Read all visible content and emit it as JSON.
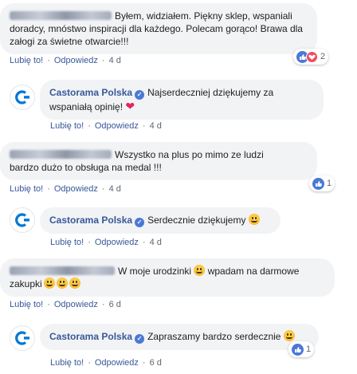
{
  "comments": [
    {
      "text": "Byłem, widziałem. Piękny sklep, wspaniali doradcy, mnóstwo inspiracji dla każdego. Polecam gorąco! Brawa dla załogi za świetne otwarcie!!!",
      "like_label": "Lubię to!",
      "reply_label": "Odpowiedz",
      "time": "4 d",
      "reactions_count": "2"
    },
    {
      "author": "Castorama Polska",
      "text": "Najserdeczniej dziękujemy za wspaniałą opinię!",
      "like_label": "Lubię to!",
      "reply_label": "Odpowiedz",
      "time": "4 d"
    },
    {
      "text": "Wszystko na plus po mimo ze ludzi bardzo dużo to obsługa na medal !!!",
      "like_label": "Lubię to!",
      "reply_label": "Odpowiedz",
      "time": "4 d",
      "reactions_count": "1"
    },
    {
      "author": "Castorama Polska",
      "text": "Serdecznie dziękujemy",
      "like_label": "Lubię to!",
      "reply_label": "Odpowiedz",
      "time": "4 d"
    },
    {
      "text_part1": "W moje urodzinki",
      "text_part2": "wpadam na darmowe zakupki",
      "like_label": "Lubię to!",
      "reply_label": "Odpowiedz",
      "time": "6 d"
    },
    {
      "author": "Castorama Polska",
      "text": "Zapraszamy bardzo serdecznie",
      "like_label": "Lubię to!",
      "reply_label": "Odpowiedz",
      "time": "6 d",
      "reactions_count": "1"
    }
  ],
  "dot": "·",
  "icons": {
    "verified": "verified-badge-icon",
    "like": "like-reaction-icon",
    "love": "love-reaction-icon",
    "logo": "castorama-logo-icon"
  },
  "colors": {
    "link": "#385898",
    "bubble": "#f2f3f5",
    "like": "#4a78d6",
    "love": "#ee4d63",
    "brand": "#0078d7"
  }
}
